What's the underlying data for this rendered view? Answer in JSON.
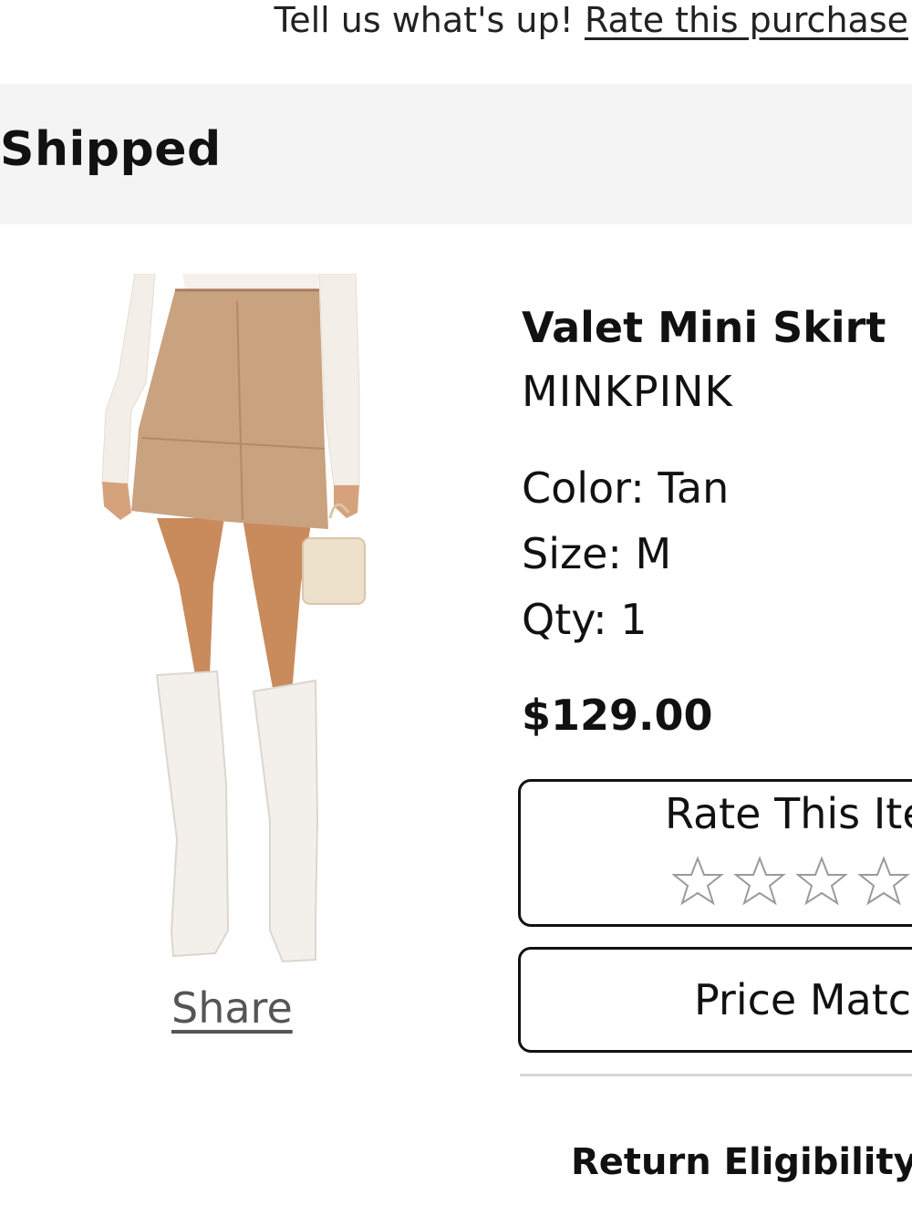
{
  "feedback": {
    "prompt": "Tell us what's up!",
    "link_label": "Rate this purchase"
  },
  "order": {
    "status": "Shipped"
  },
  "product": {
    "name": "Valet Mini Skirt",
    "brand": "MINKPINK",
    "color_label": "Color: Tan",
    "size_label": "Size: M",
    "qty_label": "Qty: 1",
    "price": "$129.00",
    "share_label": "Share"
  },
  "rating": {
    "title": "Rate This Item",
    "stars_visible": 4,
    "value": 0
  },
  "actions": {
    "price_match_label": "Price Match",
    "return_eligibility_label": "Return Eligibility"
  },
  "colors": {
    "status_bar_bg": "#f4f4f4",
    "skirt": "#c9a27f",
    "boots": "#f3f0ec",
    "star_outline": "#9a9a9a"
  },
  "icons": {
    "star": "star-outline-icon"
  }
}
